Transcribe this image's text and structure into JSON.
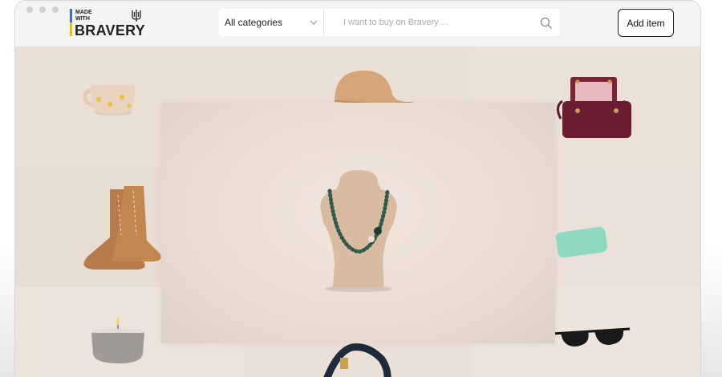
{
  "window": {
    "controls": [
      "close",
      "minimize",
      "maximize"
    ]
  },
  "header": {
    "logo": {
      "line1": "MADE",
      "line2": "WITH",
      "wordmark": "BRAVERY",
      "icon": "trident-icon",
      "colors": [
        "#3e6fd1",
        "#f2c20b"
      ]
    },
    "category_select": {
      "selected": "All categories",
      "icon": "chevron-down-icon"
    },
    "search": {
      "placeholder": "I want to buy on Bravery ...",
      "icon": "search-icon"
    },
    "add_item_label": "Add item"
  },
  "products": [
    {
      "name": "ceramic-cup"
    },
    {
      "name": "baseball-cap"
    },
    {
      "name": "leather-handbag"
    },
    {
      "name": "lace-up-boots"
    },
    {
      "name": "necklace"
    },
    {
      "name": "soap-bar"
    },
    {
      "name": "candle"
    },
    {
      "name": "bag-strap"
    },
    {
      "name": "sunglasses"
    }
  ]
}
